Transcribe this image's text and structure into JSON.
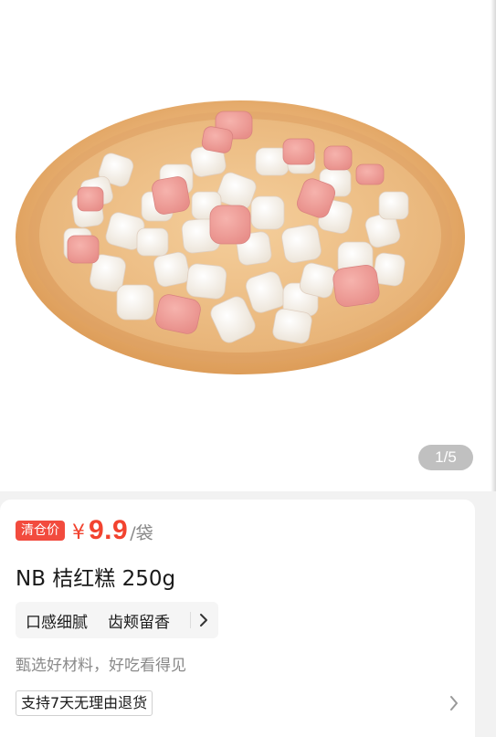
{
  "gallery": {
    "image_alt": "NB 桔红糕 250g product photo on wooden plate",
    "counter": "1/5"
  },
  "price": {
    "tag": "清仓价",
    "currency": "¥",
    "amount": "9.9",
    "unit": "/袋"
  },
  "product": {
    "title": "NB 桔红糕 250g"
  },
  "features": {
    "items": [
      "口感细腻",
      "齿颊留香"
    ],
    "more_icon": "chevron-right-icon"
  },
  "tagline": "甄选好材料，好吃看得见",
  "service": {
    "label": "支持7天无理由退货",
    "more_icon": "chevron-right-icon"
  },
  "colors": {
    "price_red": "#f2432f",
    "tag_red": "#f24b3e",
    "plate_wood": "#e8b37a"
  }
}
